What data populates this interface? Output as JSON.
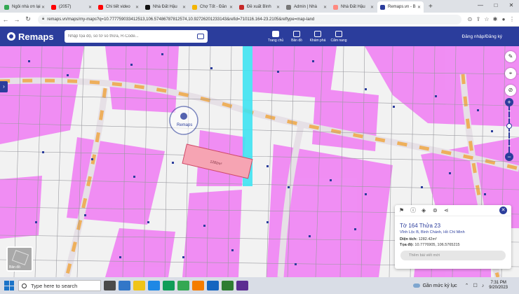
{
  "browser": {
    "tabs": [
      {
        "label": "Ngôi nhà ơn lại",
        "color": "#34a853"
      },
      {
        "label": "(2057)",
        "color": "#ff0000"
      },
      {
        "label": "Chi tiết video",
        "color": "#ff0000"
      },
      {
        "label": "Nhà Đất Hậu",
        "color": "#111111"
      },
      {
        "label": "Chợ Tốt - Đăn",
        "color": "#f4b400"
      },
      {
        "label": "Đề xuất Bình",
        "color": "#c62828"
      },
      {
        "label": "Admin | Nhà",
        "color": "#777777"
      },
      {
        "label": "Nhà Đất Hậu",
        "color": "#ff8a80"
      },
      {
        "label": "Remaps.vn - B",
        "color": "#2b3d9c",
        "active": true
      }
    ],
    "new_tab": "+",
    "url": "remaps.vn/maps/my-maps?q=10.777759033412513,106.57486787812574,10.92726201233143&refid=710116.164-23.2105&reftype=map-land",
    "window_controls": [
      "—",
      "□",
      "✕"
    ]
  },
  "header": {
    "logo_text": "Remaps",
    "search_placeholder": "Nhập tọa độ, số tờ số thửa, R-Code...",
    "nav": [
      {
        "label": "Trang chủ",
        "icon": "home-icon",
        "active": true
      },
      {
        "label": "Bản đồ",
        "icon": "map-icon"
      },
      {
        "label": "Khám phá",
        "icon": "explore-icon"
      },
      {
        "label": "Cẩm nang",
        "icon": "handbook-icon"
      }
    ],
    "login": "Đăng nhập/Đăng ký"
  },
  "map": {
    "watermark": "Remaps",
    "layer_label": "Bản đồ",
    "zoom_in": "+",
    "zoom_out": "−",
    "parcel_label": "1282m²"
  },
  "info_card": {
    "title": "Tờ 164 Thửa 23",
    "address": "Vĩnh Lộc B, Bình Chánh, Hồ Chí Minh",
    "area_label": "Diện tích:",
    "area_value": "1282.42m²",
    "coord_label": "Tọa độ:",
    "coord_value": "10.7776905, 106.5765215",
    "post_button": "Thêm bài viết mới"
  },
  "taskbar": {
    "search_placeholder": "Type here to search",
    "weather": "Gần mức kỷ lục",
    "time": "7:31 PM",
    "date": "9/20/2023",
    "apps": [
      "#4a4a4a",
      "#3277c8",
      "#f0c419",
      "#1e88e5",
      "#0f9d58",
      "#34a853",
      "#f57c00",
      "#1565c0",
      "#2e7d32",
      "#5c2d91"
    ]
  }
}
